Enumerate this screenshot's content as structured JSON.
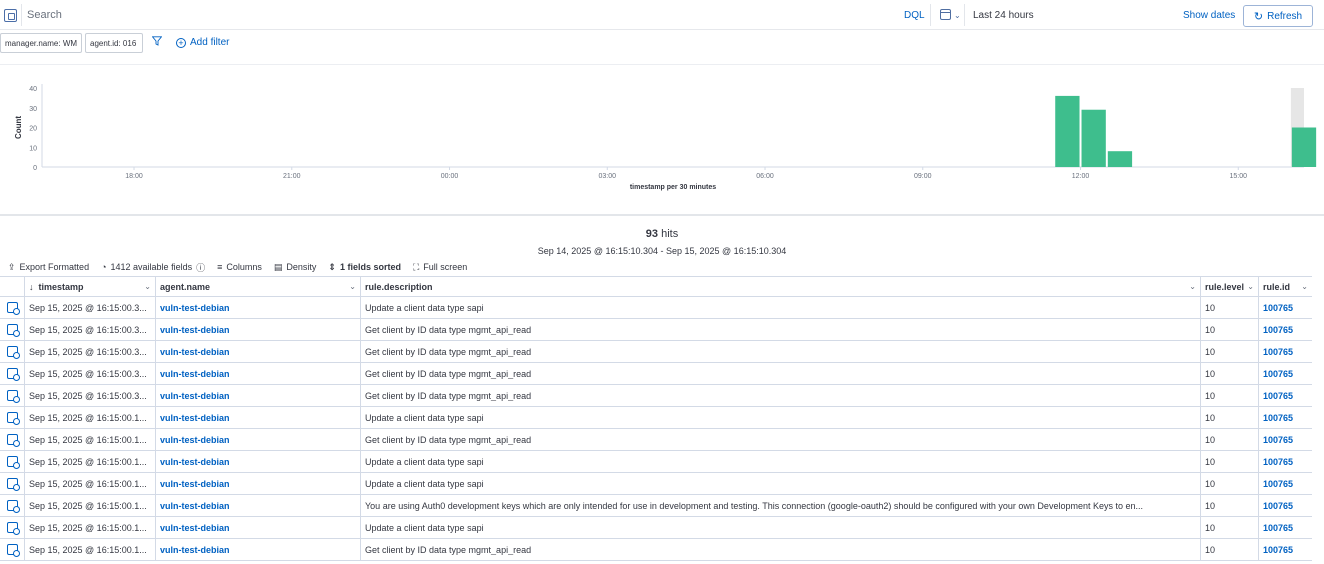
{
  "query_bar": {
    "search_placeholder": "Search",
    "language": "DQL",
    "date_range": "Last 24 hours",
    "show_dates": "Show dates",
    "refresh_label": "Refresh"
  },
  "filters": {
    "pills": [
      "manager.name: WM",
      "agent.id: 016"
    ],
    "add_filter": "Add filter"
  },
  "chart_data": {
    "type": "bar",
    "ylabel": "Count",
    "xlabel": "timestamp per 30 minutes",
    "ylim": [
      0,
      40
    ],
    "yticks": [
      0,
      10,
      20,
      30,
      40
    ],
    "x_ticks": [
      "18:00",
      "21:00",
      "00:00",
      "03:00",
      "06:00",
      "09:00",
      "12:00",
      "15:00"
    ],
    "x_start_hour": 16.25,
    "x_end_hour": 40.25,
    "bars": [
      {
        "start_hour": 35.5,
        "value": 36
      },
      {
        "start_hour": 36.0,
        "value": 29
      },
      {
        "start_hour": 36.5,
        "value": 8
      },
      {
        "start_hour": 40.0,
        "value": 20
      }
    ],
    "bar_color": "#3ebe8d",
    "grid": false
  },
  "summary": {
    "hits_count": "93",
    "hits_label": "hits",
    "range": "Sep 14, 2025 @ 16:15:10.304 - Sep 15, 2025 @ 16:15:10.304"
  },
  "toolbar": {
    "export": "Export Formatted",
    "fields": "1412 available fields",
    "columns": "Columns",
    "density": "Density",
    "sorted": "1 fields sorted",
    "fullscreen": "Full screen"
  },
  "table": {
    "headers": {
      "timestamp": "timestamp",
      "agent": "agent.name",
      "description": "rule.description",
      "level": "rule.level",
      "rule_id": "rule.id"
    },
    "rows": [
      {
        "ts": "Sep 15, 2025 @ 16:15:00.3...",
        "agent": "vuln-test-debian",
        "desc": "Update a client data type sapi",
        "level": "10",
        "rule": "100765"
      },
      {
        "ts": "Sep 15, 2025 @ 16:15:00.3...",
        "agent": "vuln-test-debian",
        "desc": "Get client by ID data type mgmt_api_read",
        "level": "10",
        "rule": "100765"
      },
      {
        "ts": "Sep 15, 2025 @ 16:15:00.3...",
        "agent": "vuln-test-debian",
        "desc": "Get client by ID data type mgmt_api_read",
        "level": "10",
        "rule": "100765"
      },
      {
        "ts": "Sep 15, 2025 @ 16:15:00.3...",
        "agent": "vuln-test-debian",
        "desc": "Get client by ID data type mgmt_api_read",
        "level": "10",
        "rule": "100765"
      },
      {
        "ts": "Sep 15, 2025 @ 16:15:00.3...",
        "agent": "vuln-test-debian",
        "desc": "Get client by ID data type mgmt_api_read",
        "level": "10",
        "rule": "100765"
      },
      {
        "ts": "Sep 15, 2025 @ 16:15:00.1...",
        "agent": "vuln-test-debian",
        "desc": "Update a client data type sapi",
        "level": "10",
        "rule": "100765"
      },
      {
        "ts": "Sep 15, 2025 @ 16:15:00.1...",
        "agent": "vuln-test-debian",
        "desc": "Get client by ID data type mgmt_api_read",
        "level": "10",
        "rule": "100765"
      },
      {
        "ts": "Sep 15, 2025 @ 16:15:00.1...",
        "agent": "vuln-test-debian",
        "desc": "Update a client data type sapi",
        "level": "10",
        "rule": "100765"
      },
      {
        "ts": "Sep 15, 2025 @ 16:15:00.1...",
        "agent": "vuln-test-debian",
        "desc": "Update a client data type sapi",
        "level": "10",
        "rule": "100765"
      },
      {
        "ts": "Sep 15, 2025 @ 16:15:00.1...",
        "agent": "vuln-test-debian",
        "desc": "You are using Auth0 development keys which are only intended for use in development and testing. This connection (google-oauth2) should be configured with your own Development Keys to en...",
        "level": "10",
        "rule": "100765"
      },
      {
        "ts": "Sep 15, 2025 @ 16:15:00.1...",
        "agent": "vuln-test-debian",
        "desc": "Update a client data type sapi",
        "level": "10",
        "rule": "100765"
      },
      {
        "ts": "Sep 15, 2025 @ 16:15:00.1...",
        "agent": "vuln-test-debian",
        "desc": "Get client by ID data type mgmt_api_read",
        "level": "10",
        "rule": "100765"
      }
    ]
  },
  "colors": {
    "link": "#0061c2",
    "bar": "#3ebe8d",
    "border": "#d3dae6"
  }
}
